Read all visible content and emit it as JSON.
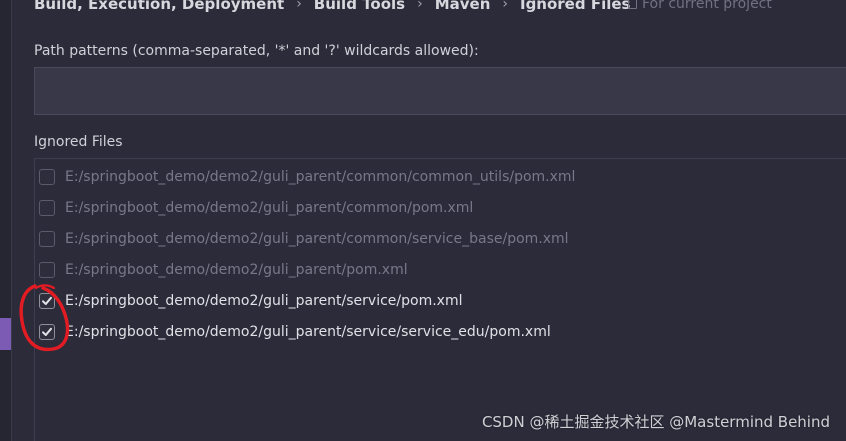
{
  "breadcrumb": {
    "items": [
      "Build, Execution, Deployment",
      "Build Tools",
      "Maven",
      "Ignored Files"
    ],
    "separator": "›"
  },
  "scope": {
    "icon": "project-icon",
    "label": "For current project"
  },
  "path_patterns": {
    "label": "Path patterns (comma-separated, '*' and '?' wildcards allowed):",
    "value": ""
  },
  "ignored_files": {
    "label": "Ignored Files",
    "items": [
      {
        "path": "E:/springboot_demo/demo2/guli_parent/common/common_utils/pom.xml",
        "checked": false
      },
      {
        "path": "E:/springboot_demo/demo2/guli_parent/common/pom.xml",
        "checked": false
      },
      {
        "path": "E:/springboot_demo/demo2/guli_parent/common/service_base/pom.xml",
        "checked": false
      },
      {
        "path": "E:/springboot_demo/demo2/guli_parent/pom.xml",
        "checked": false
      },
      {
        "path": "E:/springboot_demo/demo2/guli_parent/service/pom.xml",
        "checked": true
      },
      {
        "path": "E:/springboot_demo/demo2/guli_parent/service/service_edu/pom.xml",
        "checked": true
      }
    ]
  },
  "annotation": {
    "icon": "red-circle-annotation-icon",
    "color": "#e31c23"
  },
  "watermark": "CSDN @稀土掘金技术社区 @Mastermind Behind",
  "colors": {
    "background": "#2b2b3a",
    "input_background": "#383848",
    "text": "#d0d1d7",
    "muted_text": "#777989",
    "accent": "#7b5bb3"
  }
}
